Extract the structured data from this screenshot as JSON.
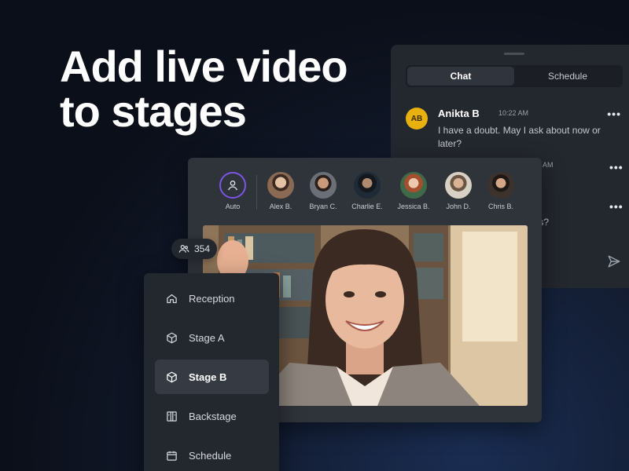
{
  "headline": {
    "line1": "Add live video",
    "line2": "to stages"
  },
  "chat": {
    "tabs": [
      {
        "label": "Chat",
        "active": true
      },
      {
        "label": "Schedule",
        "active": false
      }
    ],
    "messages": [
      {
        "initials": "AB",
        "avatar_color": "#e9b10f",
        "name": "Anikta B",
        "time": "10:22 AM",
        "text": "I have a doubt. May I ask about now or later?"
      }
    ],
    "partial_time": "AM",
    "partial_text": "ons?",
    "more_icon": "more-horizontal-icon",
    "send_icon": "send-icon"
  },
  "stage": {
    "participants": [
      {
        "name": "Auto",
        "icon": "user-icon"
      },
      {
        "name": "Alex B.",
        "color": "#8a6a52"
      },
      {
        "name": "Bryan C.",
        "color": "#5a4a42"
      },
      {
        "name": "Charlie E.",
        "color": "#2b3440"
      },
      {
        "name": "Jessica B.",
        "color": "#a46a4c"
      },
      {
        "name": "John D.",
        "color": "#c9b8a4"
      },
      {
        "name": "Chris B.",
        "color": "#4a3b33"
      }
    ],
    "viewers": "354"
  },
  "sidebar": {
    "items": [
      {
        "label": "Reception",
        "icon": "home-icon",
        "active": false
      },
      {
        "label": "Stage A",
        "icon": "cube-icon",
        "active": false
      },
      {
        "label": "Stage B",
        "icon": "cube-icon",
        "active": true
      },
      {
        "label": "Backstage",
        "icon": "backstage-icon",
        "active": false
      },
      {
        "label": "Schedule",
        "icon": "calendar-icon",
        "active": false
      }
    ]
  },
  "colors": {
    "accent": "#7b55e5",
    "avatar_yellow": "#e9b10f",
    "panel": "#23272e"
  }
}
